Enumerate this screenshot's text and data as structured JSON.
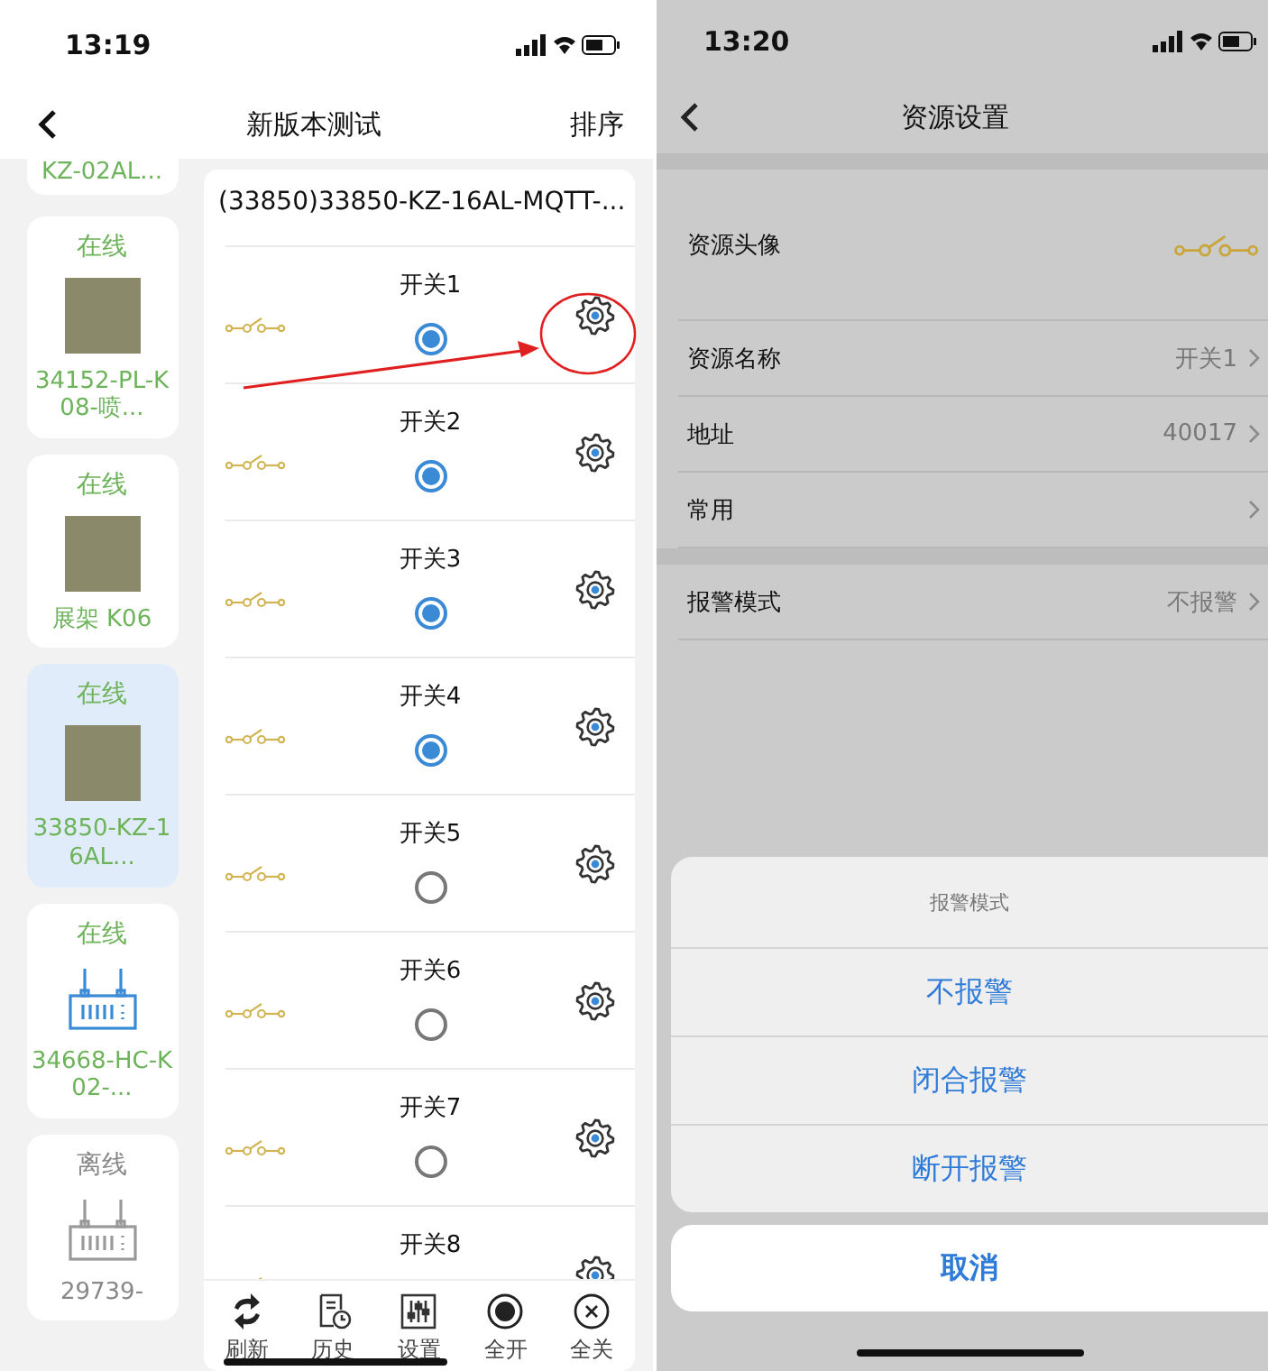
{
  "device_screen": {
    "status_bar": {
      "time": "13:19"
    },
    "nav": {
      "title": "新版本测试",
      "action": "排序"
    },
    "devices": [
      {
        "name": "KZ-02AL...",
        "selected": false
      },
      {
        "status": "在线",
        "online": true,
        "kind": "photo",
        "name": "34152-PL-K08-喷...",
        "selected": false
      },
      {
        "status": "在线",
        "online": true,
        "kind": "photo",
        "name": "展架 K06",
        "selected": false
      },
      {
        "status": "在线",
        "online": true,
        "kind": "photo",
        "name": "33850-KZ-16AL...",
        "selected": true
      },
      {
        "status": "在线",
        "online": true,
        "kind": "router",
        "name": "34668-HC-K02-...",
        "selected": false
      },
      {
        "status": "离线",
        "online": false,
        "kind": "router",
        "name": "29739-",
        "selected": false
      }
    ],
    "panel_title": "(33850)33850-KZ-16AL-MQTT-...",
    "switches": [
      {
        "label": "开关1",
        "selected": true
      },
      {
        "label": "开关2",
        "selected": true
      },
      {
        "label": "开关3",
        "selected": true
      },
      {
        "label": "开关4",
        "selected": true
      },
      {
        "label": "开关5",
        "selected": false
      },
      {
        "label": "开关6",
        "selected": false
      },
      {
        "label": "开关7",
        "selected": false
      },
      {
        "label": "开关8"
      }
    ],
    "toolbar": [
      {
        "kind": "refresh",
        "label": "刷新"
      },
      {
        "kind": "history",
        "label": "历史"
      },
      {
        "kind": "settings",
        "label": "设置"
      },
      {
        "kind": "all-on",
        "label": "全开"
      },
      {
        "kind": "all-off",
        "label": "全关"
      }
    ]
  },
  "settings_screen": {
    "status_bar": {
      "time": "13:20"
    },
    "nav": {
      "title": "资源设置"
    },
    "rows": [
      {
        "kind": "icon",
        "label": "资源头像"
      },
      {
        "kind": "value",
        "label": "资源名称",
        "value": "开关1"
      },
      {
        "kind": "value",
        "label": "地址",
        "value": "40017"
      },
      {
        "kind": "value",
        "label": "常用"
      }
    ],
    "alarm_rows": [
      {
        "kind": "value",
        "label": "报警模式",
        "value": "不报警"
      }
    ],
    "action_sheet": {
      "title": "报警模式",
      "options": [
        "不报警",
        "闭合报警",
        "断开报警"
      ],
      "cancel": "取消"
    }
  }
}
